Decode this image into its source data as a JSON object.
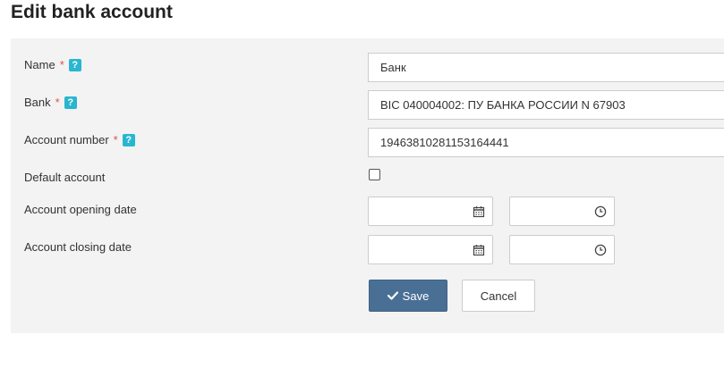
{
  "page": {
    "title": "Edit bank account"
  },
  "form": {
    "name": {
      "label": "Name",
      "required_mark": "*",
      "help": "?",
      "value": "Банк"
    },
    "bank": {
      "label": "Bank",
      "required_mark": "*",
      "help": "?",
      "value": "BIC 040004002:  ПУ БАНКА РОССИИ N 67903"
    },
    "account_number": {
      "label": "Account number",
      "required_mark": "*",
      "help": "?",
      "value": "19463810281153164441"
    },
    "default_account": {
      "label": "Default account",
      "checked": false
    },
    "opening_date": {
      "label": "Account opening date",
      "date_value": "",
      "time_value": "",
      "date_icon": "calendar-icon",
      "time_icon": "clock-icon"
    },
    "closing_date": {
      "label": "Account closing date",
      "date_value": "",
      "time_value": "",
      "date_icon": "calendar-icon",
      "time_icon": "clock-icon"
    }
  },
  "buttons": {
    "save_label": "Save",
    "save_icon": "checkmark-icon",
    "cancel_label": "Cancel"
  },
  "colors": {
    "primary_button": "#4a6f95",
    "help_badge": "#29b6cf",
    "required_star": "#d9534f",
    "panel_background": "#f3f3f3"
  }
}
